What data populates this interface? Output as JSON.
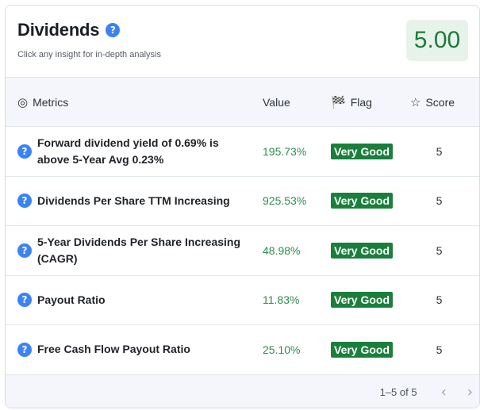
{
  "header": {
    "title": "Dividends",
    "subtitle": "Click any insight for in-depth analysis",
    "score": "5.00",
    "help_icon": "question-circle-icon"
  },
  "colors": {
    "accent_blue": "#3b82f6",
    "score_green": "#1e7a3b",
    "score_bg": "#e7f3ea",
    "flag_green": "#1a7f3c",
    "value_green": "#2e8b4e"
  },
  "table": {
    "headers": {
      "metrics": "Metrics",
      "value": "Value",
      "flag": "Flag",
      "score": "Score"
    },
    "header_icons": {
      "metrics": "target-icon",
      "flag": "checkered-flag-icon",
      "score": "star-icon"
    },
    "rows": [
      {
        "metric": "Forward dividend yield of 0.69% is above 5-Year Avg 0.23%",
        "value": "195.73%",
        "flag": "Very Good",
        "score": "5"
      },
      {
        "metric": "Dividends Per Share TTM Increasing",
        "value": "925.53%",
        "flag": "Very Good",
        "score": "5"
      },
      {
        "metric": "5-Year Dividends Per Share Increasing (CAGR)",
        "value": "48.98%",
        "flag": "Very Good",
        "score": "5"
      },
      {
        "metric": "Payout Ratio",
        "value": "11.83%",
        "flag": "Very Good",
        "score": "5"
      },
      {
        "metric": "Free Cash Flow Payout Ratio",
        "value": "25.10%",
        "flag": "Very Good",
        "score": "5"
      }
    ]
  },
  "pagination": {
    "text": "1–5 of 5",
    "prev_icon": "chevron-left-icon",
    "next_icon": "chevron-right-icon"
  }
}
